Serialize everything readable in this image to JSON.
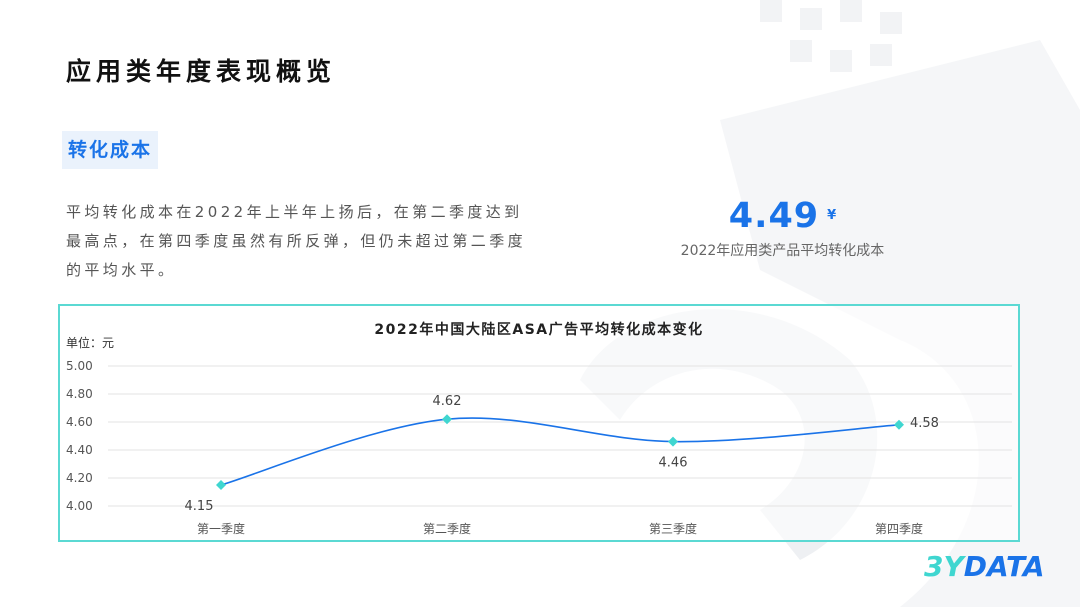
{
  "page": {
    "title": "应用类年度表现概览",
    "section_tag": "转化成本",
    "description": "平均转化成本在2022年上半年上扬后，在第二季度达到最高点，在第四季度虽然有所反弹，但仍未超过第二季度的平均水平。",
    "kpi": {
      "value": "4.49",
      "unit": "¥",
      "label": "2022年应用类产品平均转化成本"
    },
    "logo": {
      "prefix": "3Y",
      "suffix": "DATA"
    }
  },
  "colors": {
    "accent": "#1a73e8",
    "line": "#1a73e8",
    "marker": "#3fd6d0",
    "frame": "#5bd9d3",
    "logo_prefix": "#3fd6d0",
    "logo_suffix": "#1a73e8"
  },
  "chart_data": {
    "type": "line",
    "title": "2022年中国大陆区ASA广告平均转化成本变化",
    "unit_label": "单位：元",
    "categories": [
      "第一季度",
      "第二季度",
      "第三季度",
      "第四季度"
    ],
    "values": [
      4.15,
      4.62,
      4.46,
      4.58
    ],
    "data_labels": [
      "4.15",
      "4.62",
      "4.46",
      "4.58"
    ],
    "label_positions": [
      "below",
      "above",
      "below",
      "right"
    ],
    "ylim": [
      4.0,
      5.0
    ],
    "yticks": [
      "4.00",
      "4.20",
      "4.40",
      "4.60",
      "4.80",
      "5.00"
    ],
    "grid": true,
    "smooth": true
  }
}
